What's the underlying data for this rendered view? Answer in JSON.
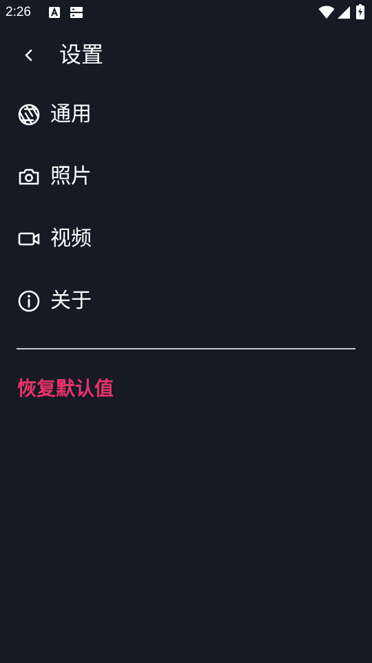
{
  "status_bar": {
    "time": "2:26",
    "icons": [
      "a-font-icon",
      "storage-icon",
      "wifi-icon",
      "cell-signal-icon",
      "battery-charging-icon"
    ]
  },
  "header": {
    "back_icon": "chevron-left-icon",
    "title": "设置"
  },
  "menu": {
    "items": [
      {
        "label": "通用",
        "icon": "aperture-icon"
      },
      {
        "label": "照片",
        "icon": "camera-icon"
      },
      {
        "label": "视频",
        "icon": "video-icon"
      },
      {
        "label": "关于",
        "icon": "info-icon"
      }
    ]
  },
  "reset": {
    "label": "恢复默认值"
  },
  "colors": {
    "background": "#161a22",
    "text": "#ffffff",
    "accent": "#e6336a",
    "divider": "#c8cacf"
  }
}
